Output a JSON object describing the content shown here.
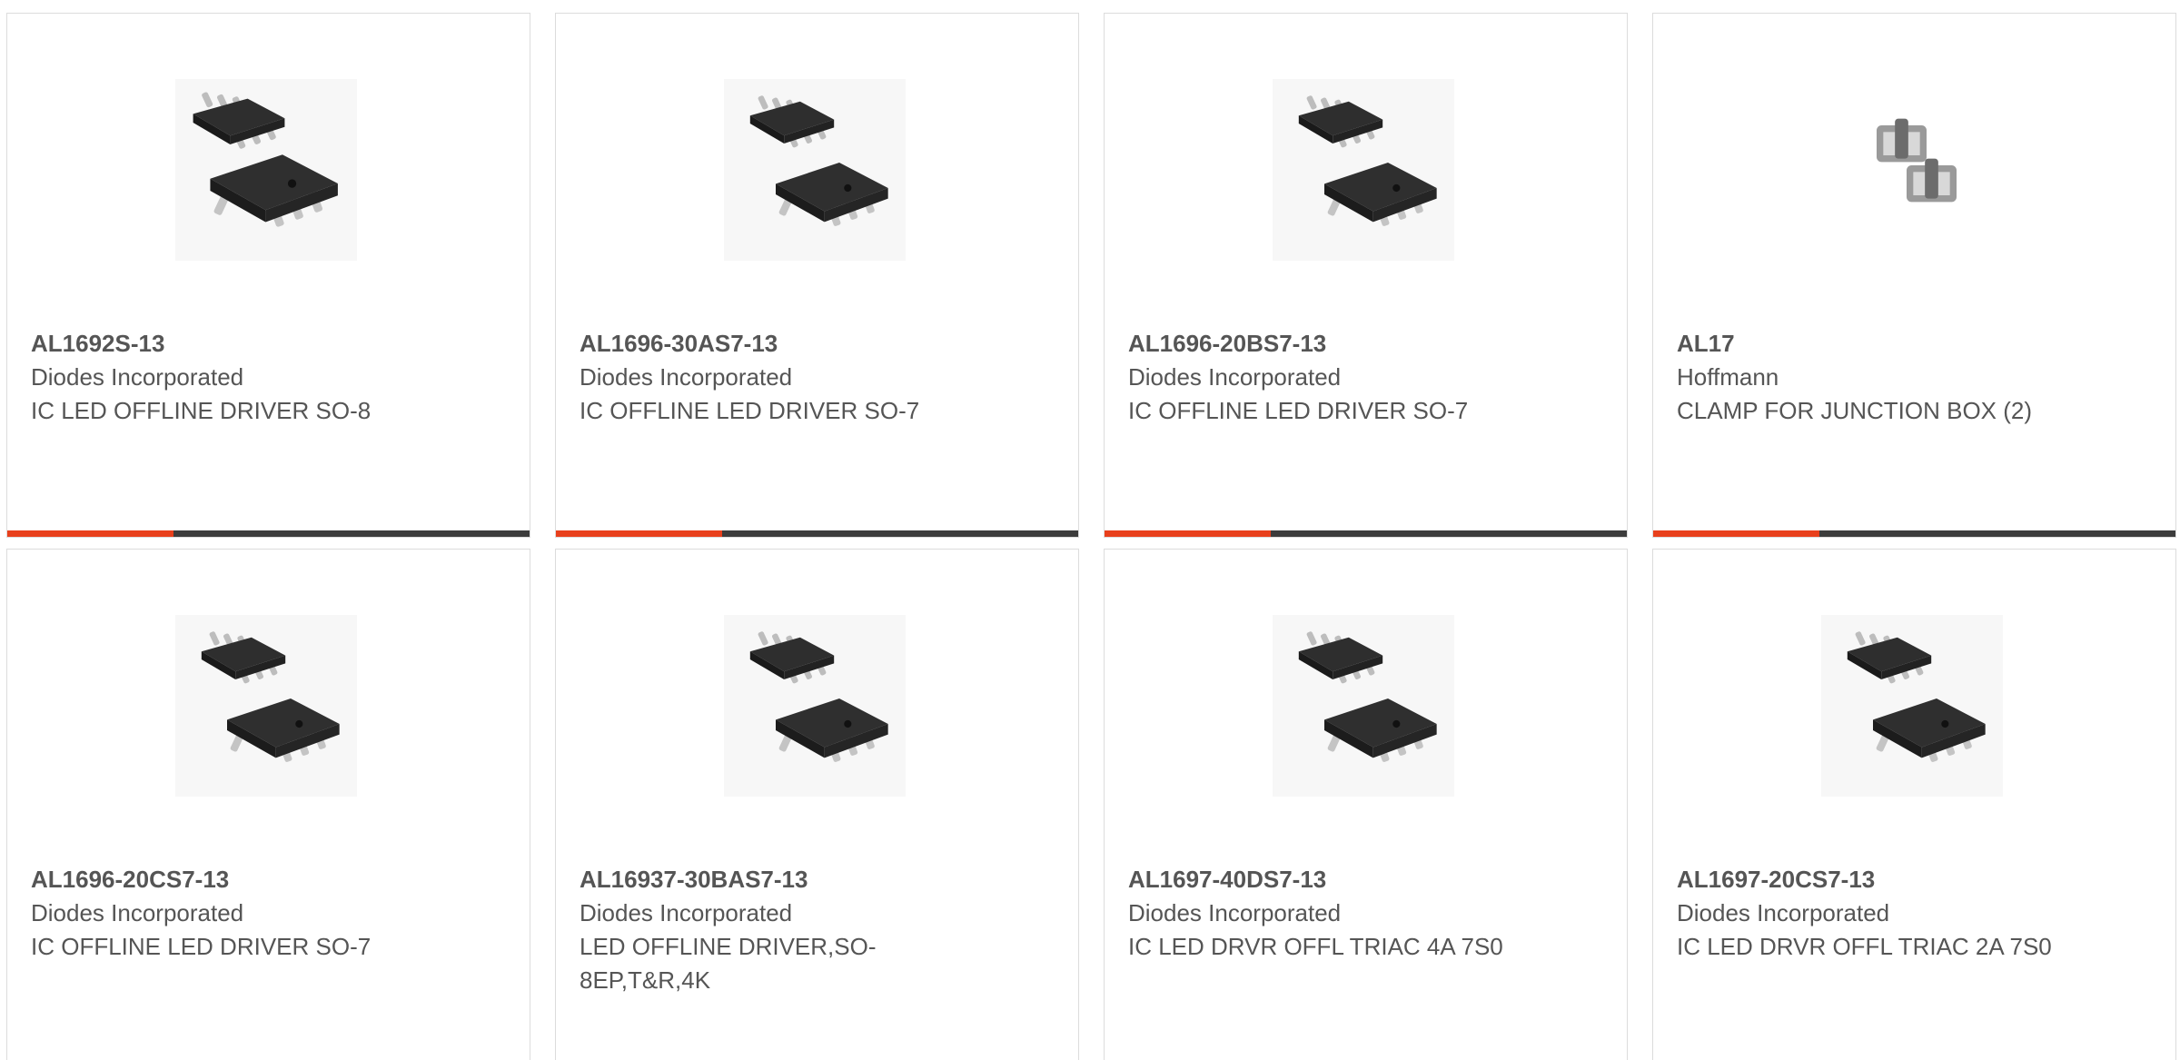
{
  "colors": {
    "accent": "#e8401c",
    "bar": "#3c3c3c",
    "text": "#555555",
    "border": "#dcdcdc"
  },
  "products": [
    {
      "part_number": "AL1692S-13",
      "manufacturer": "Diodes Incorporated",
      "description": "IC LED OFFLINE DRIVER SO-8",
      "image": "so8-chip-pair-icon"
    },
    {
      "part_number": "AL1696-30AS7-13",
      "manufacturer": "Diodes Incorporated",
      "description": "IC OFFLINE LED DRIVER SO-7",
      "image": "so7-chip-pair-icon"
    },
    {
      "part_number": "AL1696-20BS7-13",
      "manufacturer": "Diodes Incorporated",
      "description": "IC OFFLINE LED DRIVER SO-7",
      "image": "so7-chip-pair-icon"
    },
    {
      "part_number": "AL17",
      "manufacturer": "Hoffmann",
      "description": "CLAMP FOR JUNCTION BOX (2)",
      "image": "clamp-pair-icon"
    },
    {
      "part_number": "AL1696-20CS7-13",
      "manufacturer": "Diodes Incorporated",
      "description": "IC OFFLINE LED DRIVER SO-7",
      "image": "so7-chip-pair-icon"
    },
    {
      "part_number": "AL16937-30BAS7-13",
      "manufacturer": "Diodes Incorporated",
      "description": "LED OFFLINE DRIVER,SO-8EP,T&R,4K",
      "image": "so7-chip-pair-icon"
    },
    {
      "part_number": "AL1697-40DS7-13",
      "manufacturer": "Diodes Incorporated",
      "description": "IC LED DRVR OFFL TRIAC 4A 7S0",
      "image": "so7-chip-pair-icon"
    },
    {
      "part_number": "AL1697-20CS7-13",
      "manufacturer": "Diodes Incorporated",
      "description": "IC LED DRVR OFFL TRIAC 2A 7S0",
      "image": "so7-chip-pair-icon"
    }
  ]
}
